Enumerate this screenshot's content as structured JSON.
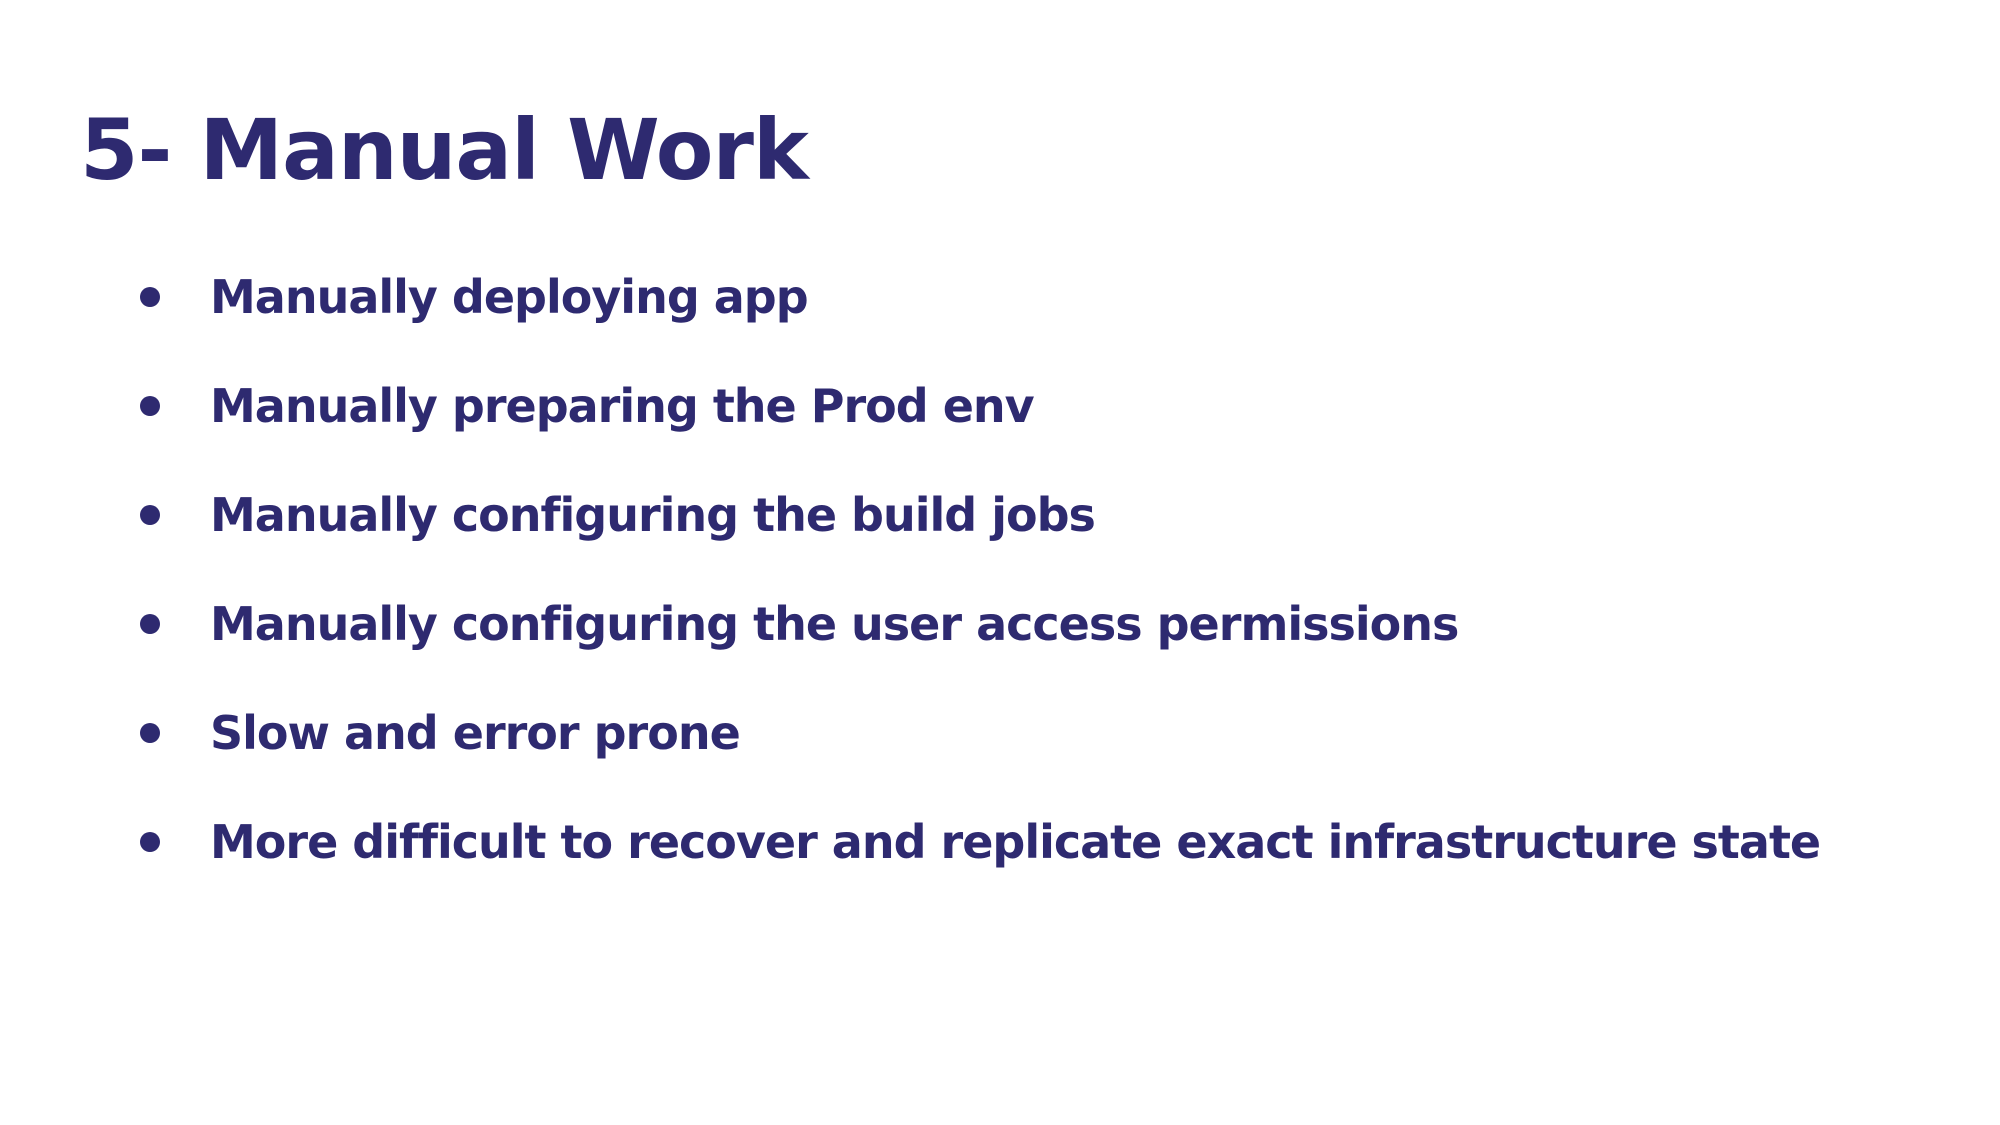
{
  "slide": {
    "title": "5- Manual Work",
    "bullets": [
      "Manually deploying app",
      "Manually preparing the Prod env",
      "Manually configuring the build jobs",
      "Manually configuring the user access permissions",
      "Slow and error prone",
      "More difficult to recover and replicate exact infrastructure state"
    ]
  },
  "colors": {
    "text": "#2e2a70",
    "background": "#ffffff"
  }
}
